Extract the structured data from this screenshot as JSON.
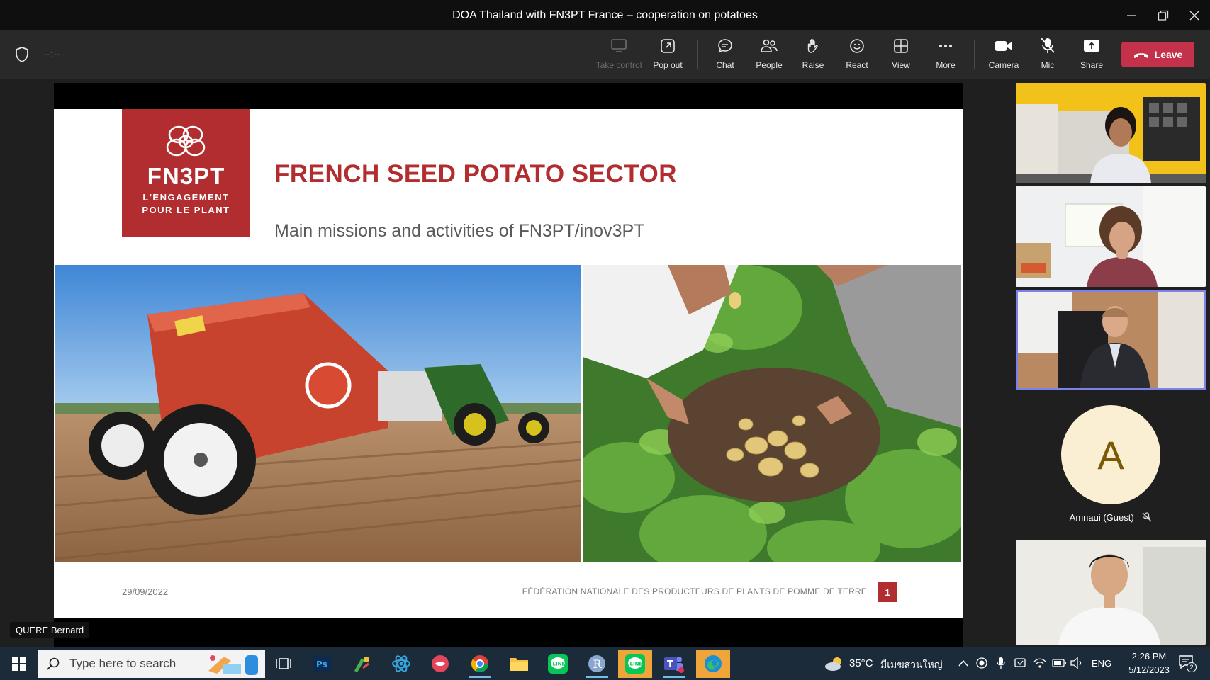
{
  "window": {
    "title": "DOA Thailand with FN3PT France – cooperation on potatoes"
  },
  "toolbar": {
    "timer": "--:--",
    "take_control": "Take control",
    "pop_out": "Pop out",
    "chat": "Chat",
    "people": "People",
    "raise": "Raise",
    "react": "React",
    "view": "View",
    "more": "More",
    "camera": "Camera",
    "mic": "Mic",
    "share": "Share",
    "leave": "Leave"
  },
  "slide": {
    "logo_name": "FN3PT",
    "logo_tag_1": "L'ENGAGEMENT",
    "logo_tag_2": "POUR LE PLANT",
    "title": "FRENCH SEED POTATO SECTOR",
    "subtitle": "Main missions and activities of FN3PT/inov3PT",
    "date": "29/09/2022",
    "federation": "FÉDÉRATION NATIONALE DES PRODUCTEURS DE PLANTS DE POMME DE TERRE",
    "page": "1",
    "presenter": "QUERE Bernard"
  },
  "participants": {
    "guest_initial": "A",
    "guest_name": "Amnaui (Guest)"
  },
  "taskbar": {
    "search_placeholder": "Type here to search",
    "weather": "35°C",
    "location": "มีเมฆส่วนใหญ่",
    "lang": "ENG",
    "time": "2:26 PM",
    "date": "5/12/2023",
    "notifications": "2"
  },
  "colors": {
    "brand_red": "#b22d2f",
    "leave_red": "#c4314b",
    "active_outline": "#7b83eb"
  }
}
